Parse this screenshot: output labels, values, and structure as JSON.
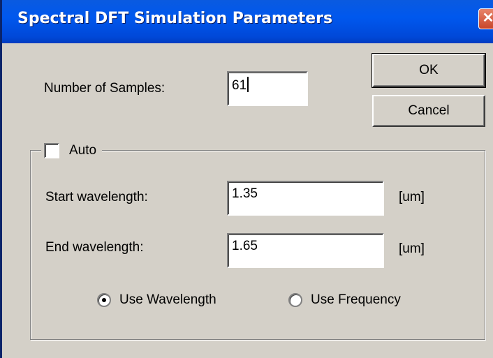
{
  "window": {
    "title": "Spectral DFT Simulation Parameters",
    "close_glyph": "✕"
  },
  "samples": {
    "label": "Number of Samples:",
    "value": "61"
  },
  "buttons": {
    "ok": "OK",
    "cancel": "Cancel"
  },
  "auto_group": {
    "checkbox_label": "Auto",
    "checked": false
  },
  "start": {
    "label": "Start wavelength:",
    "value": "1.35",
    "unit": "[um]"
  },
  "end": {
    "label": "End wavelength:",
    "value": "1.65",
    "unit": "[um]"
  },
  "mode": {
    "wavelength_label": "Use Wavelength",
    "frequency_label": "Use Frequency",
    "selected": "Use Wavelength"
  },
  "colors": {
    "titlebar": "#0058ee",
    "dialog_face": "#d4d0c8",
    "close_button": "#c8452a"
  }
}
